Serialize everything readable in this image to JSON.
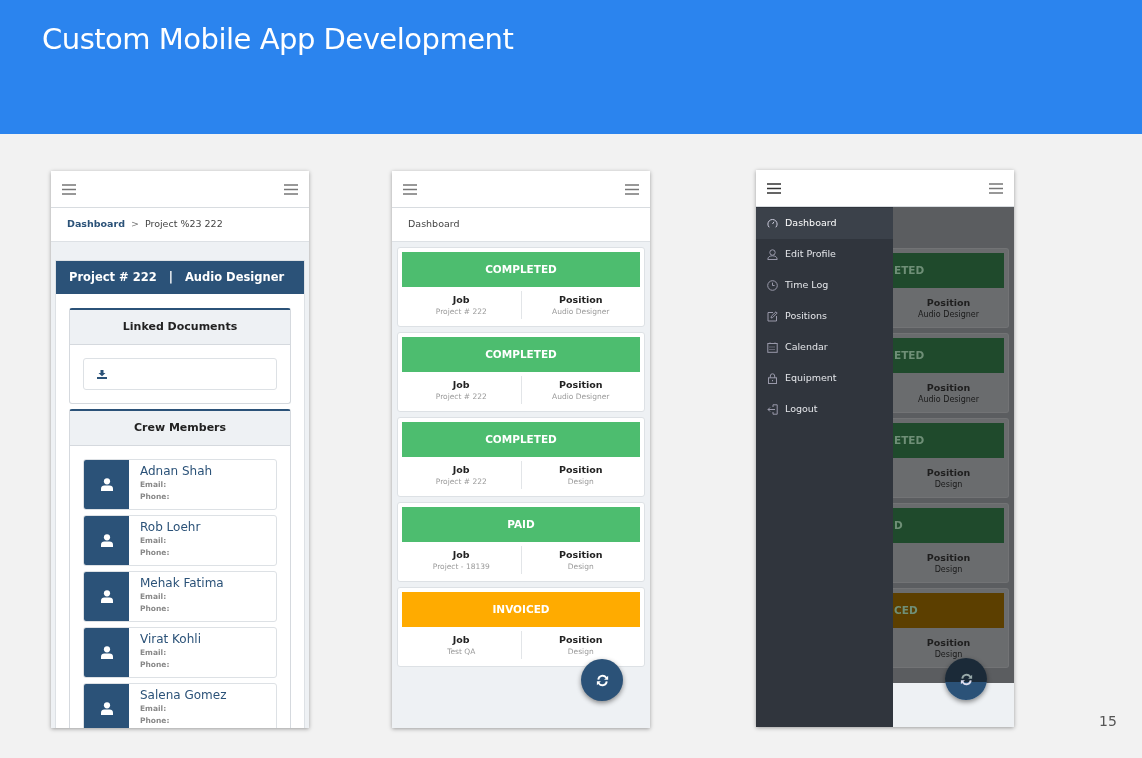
{
  "slide": {
    "title": "Custom Mobile App Development",
    "page_number": "15"
  },
  "project_screen": {
    "breadcrumb_link": "Dashboard",
    "breadcrumb_separator": ">",
    "breadcrumb_current": "Project %23 222",
    "header": [
      "Project # 222",
      "|",
      "Audio Designer"
    ],
    "documents_title": "Linked Documents",
    "crew_title": "Crew Members",
    "crew": [
      {
        "name": "Adnan Shah",
        "email_label": "Email:",
        "phone_label": "Phone:"
      },
      {
        "name": "Rob Loehr",
        "email_label": "Email:",
        "phone_label": "Phone:"
      },
      {
        "name": "Mehak Fatima",
        "email_label": "Email:",
        "phone_label": "Phone:"
      },
      {
        "name": "Virat Kohli",
        "email_label": "Email:",
        "phone_label": "Phone:"
      },
      {
        "name": "Salena Gomez",
        "email_label": "Email:",
        "phone_label": "Phone:"
      }
    ]
  },
  "dashboard_screen": {
    "breadcrumb": "Dashboard",
    "jobs": [
      {
        "status": "COMPLETED",
        "color": "#4dbd6f",
        "job_label": "Job",
        "job_value": "Project # 222",
        "position_label": "Position",
        "position_value": "Audio Designer"
      },
      {
        "status": "COMPLETED",
        "color": "#4dbd6f",
        "job_label": "Job",
        "job_value": "Project # 222",
        "position_label": "Position",
        "position_value": "Audio Designer"
      },
      {
        "status": "COMPLETED",
        "color": "#4dbd6f",
        "job_label": "Job",
        "job_value": "Project # 222",
        "position_label": "Position",
        "position_value": "Design"
      },
      {
        "status": "PAID",
        "color": "#4dbd6f",
        "job_label": "Job",
        "job_value": "Project - 18139",
        "position_label": "Position",
        "position_value": "Design"
      },
      {
        "status": "INVOICED",
        "color": "#ffab00",
        "job_label": "Job",
        "job_value": "Test QA",
        "position_label": "Position",
        "position_value": "Design"
      }
    ]
  },
  "menu_screen": {
    "menu": [
      {
        "label": "Dashboard",
        "selected": true
      },
      {
        "label": "Edit Profile",
        "selected": false
      },
      {
        "label": "Time Log",
        "selected": false
      },
      {
        "label": "Positions",
        "selected": false
      },
      {
        "label": "Calendar",
        "selected": false
      },
      {
        "label": "Equipment",
        "selected": false
      },
      {
        "label": "Logout",
        "selected": false
      }
    ],
    "cards_behind": [
      {
        "status": "ETED",
        "color": "#1f4a2c",
        "position_label": "Position",
        "position_value": "Audio Designer"
      },
      {
        "status": "ETED",
        "color": "#1f4a2c",
        "position_label": "Position",
        "position_value": "Audio Designer"
      },
      {
        "status": "ETED",
        "color": "#1f4a2c",
        "position_label": "Position",
        "position_value": "Design"
      },
      {
        "status": "D",
        "color": "#1f4a2c",
        "position_label": "Position",
        "position_value": "Design"
      },
      {
        "status": "CED",
        "color": "#5c3f00",
        "position_label": "Position",
        "position_value": "Design"
      }
    ]
  }
}
